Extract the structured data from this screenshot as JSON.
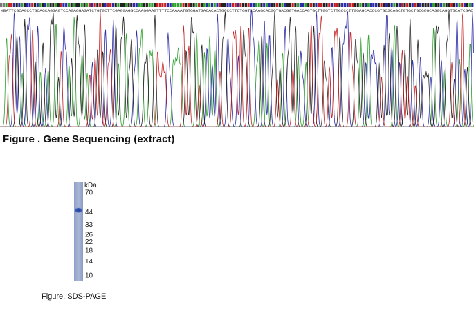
{
  "sequencing": {
    "caption": "Figure . Gene Sequencing (extract)",
    "base_calls": "XBATTCGCAGCCTGCAGCAGGAGTCCAGAGGAGATCTGTGCTTCGAGGAGGCCAAGGAAGTTTTCCAAAATGTGGATGACACACTGGCCTTCTGGTCCAAGCACGGTGACGGTGACCAGTGCTTGGTCTTGCCCTTGGAGCACCCGTGCGCAGCTGTGCTGCGGGCAGGCAGGTGCATCGAC",
    "channels": [
      {
        "base": "A",
        "color": "#2fa02f"
      },
      {
        "base": "C",
        "color": "#2b2ba8"
      },
      {
        "base": "G",
        "color": "#222222"
      },
      {
        "base": "T",
        "color": "#c42222"
      }
    ]
  },
  "sds_page": {
    "caption": "Figure. SDS-PAGE",
    "unit": "kDa",
    "markers": [
      "70",
      "44",
      "33",
      "26",
      "22",
      "18",
      "14",
      "10"
    ],
    "band_at_kda": 45
  }
}
